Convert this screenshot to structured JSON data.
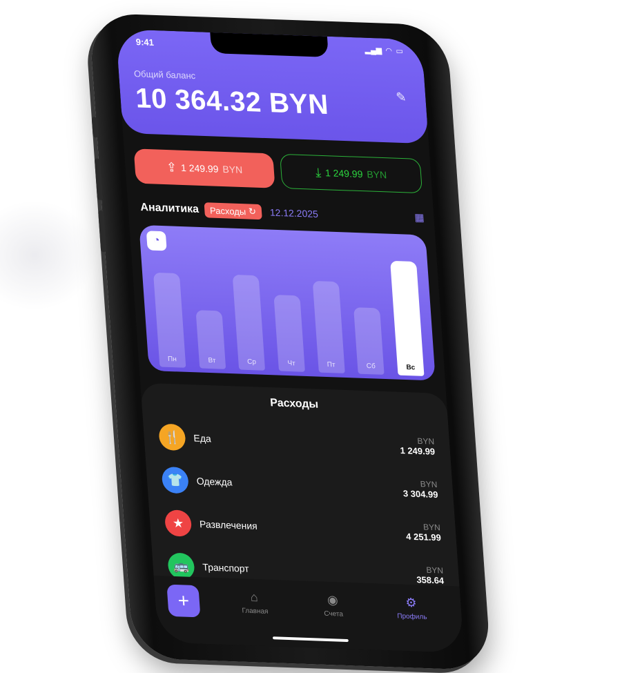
{
  "status": {
    "time": "9:41"
  },
  "balance": {
    "caption": "Общий баланс",
    "amount": "10 364.32 BYN"
  },
  "pills": {
    "outgoing": {
      "value": "1 249.99",
      "currency": "BYN"
    },
    "incoming": {
      "value": "1 249.99",
      "currency": "BYN"
    }
  },
  "analytics": {
    "title": "Аналитика",
    "filter_label": "Расходы",
    "date": "12.12.2025"
  },
  "chart_data": {
    "type": "bar",
    "categories": [
      "Пн",
      "Вт",
      "Ср",
      "Чт",
      "Пт",
      "Сб",
      "Вс"
    ],
    "values": [
      0.78,
      0.48,
      0.79,
      0.63,
      0.76,
      0.55,
      0.95
    ],
    "selected": "Вс",
    "title": "",
    "xlabel": "",
    "ylabel": ""
  },
  "expenses": {
    "title": "Расходы",
    "items": [
      {
        "name": "Еда",
        "currency": "BYN",
        "amount": "1 249.99",
        "color": "#f5a524",
        "icon": "fork-knife-icon"
      },
      {
        "name": "Одежда",
        "currency": "BYN",
        "amount": "3 304.99",
        "color": "#3b82f6",
        "icon": "shirt-icon"
      },
      {
        "name": "Развлечения",
        "currency": "BYN",
        "amount": "4 251.99",
        "color": "#ef4444",
        "icon": "star-icon"
      },
      {
        "name": "Транспорт",
        "currency": "BYN",
        "amount": "358.64",
        "color": "#22c55e",
        "icon": "bus-icon"
      }
    ]
  },
  "tabbar": {
    "add_label": "+",
    "tabs": [
      {
        "label": "Главная",
        "icon": "home-icon"
      },
      {
        "label": "Счета",
        "icon": "wallet-icon"
      },
      {
        "label": "Профиль",
        "icon": "gear-icon"
      }
    ]
  },
  "colors": {
    "accent": "#7b67f5",
    "expense": "#f2615b",
    "income": "#2cd63f"
  }
}
